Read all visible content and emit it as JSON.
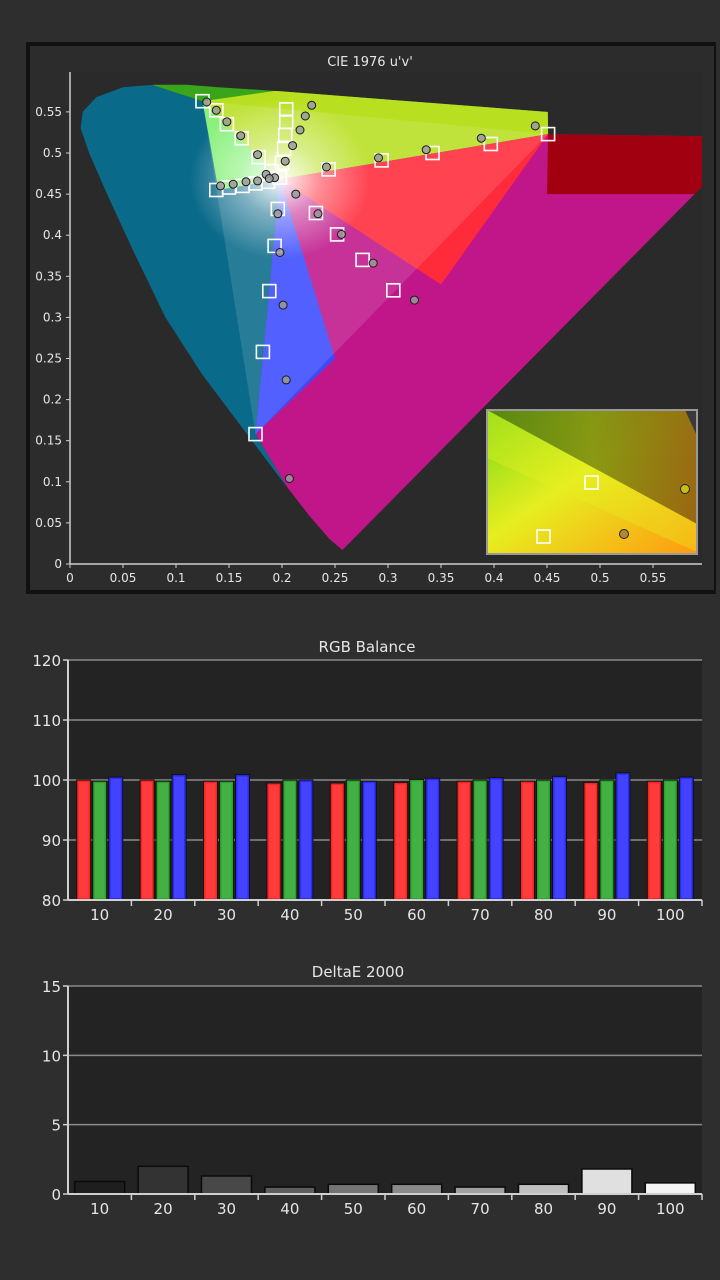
{
  "chart_data": [
    {
      "type": "scatter",
      "title": "CIE 1976 u'v'",
      "x_ticks": [
        "0",
        "0.05",
        "0.1",
        "0.15",
        "0.2",
        "0.25",
        "0.3",
        "0.35",
        "0.4",
        "0.45",
        "0.5",
        "0.55"
      ],
      "y_ticks": [
        "0",
        "0.05",
        "0.1",
        "0.15",
        "0.2",
        "0.25",
        "0.3",
        "0.35",
        "0.4",
        "0.45",
        "0.5",
        "0.55"
      ],
      "xlim": [
        0,
        0.6
      ],
      "ylim": [
        0,
        0.6
      ],
      "gamut_targets": {
        "red": [
          0.451,
          0.523
        ],
        "green": [
          0.125,
          0.563
        ],
        "blue": [
          0.175,
          0.158
        ],
        "white": [
          0.198,
          0.468
        ]
      },
      "series": [
        {
          "marker": "square",
          "points": [
            [
              0.125,
              0.563
            ],
            [
              0.138,
              0.552
            ],
            [
              0.148,
              0.535
            ],
            [
              0.162,
              0.518
            ],
            [
              0.178,
              0.495
            ],
            [
              0.19,
              0.478
            ],
            [
              0.198,
              0.47
            ],
            [
              0.204,
              0.553
            ],
            [
              0.204,
              0.538
            ],
            [
              0.203,
              0.522
            ],
            [
              0.202,
              0.505
            ],
            [
              0.2,
              0.488
            ],
            [
              0.138,
              0.455
            ],
            [
              0.15,
              0.458
            ],
            [
              0.163,
              0.46
            ],
            [
              0.175,
              0.463
            ],
            [
              0.187,
              0.465
            ],
            [
              0.196,
              0.432
            ],
            [
              0.193,
              0.387
            ],
            [
              0.188,
              0.332
            ],
            [
              0.182,
              0.258
            ],
            [
              0.175,
              0.158
            ],
            [
              0.244,
              0.48
            ],
            [
              0.294,
              0.491
            ],
            [
              0.342,
              0.5
            ],
            [
              0.397,
              0.511
            ],
            [
              0.451,
              0.523
            ],
            [
              0.232,
              0.427
            ],
            [
              0.252,
              0.401
            ],
            [
              0.276,
              0.37
            ],
            [
              0.305,
              0.333
            ],
            [
              0.198,
              0.47
            ]
          ]
        },
        {
          "marker": "circle",
          "points": [
            [
              0.129,
              0.562
            ],
            [
              0.138,
              0.552
            ],
            [
              0.148,
              0.538
            ],
            [
              0.161,
              0.521
            ],
            [
              0.177,
              0.498
            ],
            [
              0.185,
              0.474
            ],
            [
              0.193,
              0.47
            ],
            [
              0.228,
              0.558
            ],
            [
              0.222,
              0.545
            ],
            [
              0.217,
              0.528
            ],
            [
              0.21,
              0.509
            ],
            [
              0.203,
              0.49
            ],
            [
              0.142,
              0.46
            ],
            [
              0.154,
              0.462
            ],
            [
              0.166,
              0.465
            ],
            [
              0.177,
              0.466
            ],
            [
              0.188,
              0.469
            ],
            [
              0.196,
              0.426
            ],
            [
              0.198,
              0.379
            ],
            [
              0.201,
              0.315
            ],
            [
              0.204,
              0.224
            ],
            [
              0.207,
              0.104
            ],
            [
              0.242,
              0.483
            ],
            [
              0.291,
              0.494
            ],
            [
              0.336,
              0.504
            ],
            [
              0.388,
              0.518
            ],
            [
              0.439,
              0.533
            ],
            [
              0.213,
              0.45
            ],
            [
              0.234,
              0.426
            ],
            [
              0.256,
              0.401
            ],
            [
              0.286,
              0.366
            ],
            [
              0.325,
              0.321
            ]
          ]
        }
      ]
    },
    {
      "type": "bar",
      "title": "RGB Balance",
      "categories": [
        "10",
        "20",
        "30",
        "40",
        "50",
        "60",
        "70",
        "80",
        "90",
        "100"
      ],
      "y_ticks": [
        "80",
        "90",
        "100",
        "110",
        "120"
      ],
      "ylim": [
        80,
        120
      ],
      "colors": [
        "#ff2020",
        "#2aa52a",
        "#2a2aff"
      ],
      "series": [
        {
          "values": [
            100.0,
            100.0,
            99.8,
            99.5,
            99.5,
            99.6,
            99.8,
            99.8,
            99.6,
            99.8
          ]
        },
        {
          "values": [
            99.8,
            99.8,
            99.8,
            100.0,
            100.0,
            100.1,
            100.0,
            100.0,
            100.0,
            100.0
          ]
        },
        {
          "values": [
            100.5,
            100.9,
            100.9,
            100.0,
            99.8,
            100.3,
            100.4,
            100.6,
            101.2,
            100.5
          ]
        }
      ]
    },
    {
      "type": "bar",
      "title": "DeltaE 2000",
      "categories": [
        "10",
        "20",
        "30",
        "40",
        "50",
        "60",
        "70",
        "80",
        "90",
        "100"
      ],
      "y_ticks": [
        "0",
        "5",
        "10",
        "15"
      ],
      "ylim": [
        0,
        15
      ],
      "values": [
        0.9,
        2.0,
        1.3,
        0.5,
        0.7,
        0.7,
        0.5,
        0.7,
        1.8,
        0.8
      ],
      "fills": [
        "#1e1e1e",
        "#333333",
        "#484848",
        "#5e5e5e",
        "#747474",
        "#8a8a8a",
        "#a0a0a0",
        "#c0c0c0",
        "#e0e0e0",
        "#f4f4f4"
      ]
    }
  ]
}
